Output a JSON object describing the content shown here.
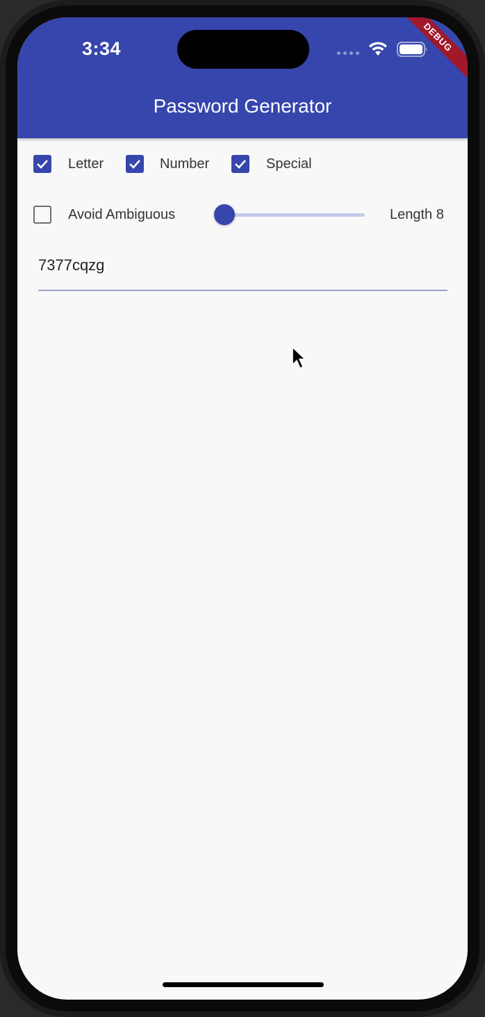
{
  "status_bar": {
    "time": "3:34"
  },
  "debug_banner": "DEBUG",
  "app_bar": {
    "title": "Password Generator"
  },
  "options": {
    "letter": {
      "label": "Letter",
      "checked": true
    },
    "number": {
      "label": "Number",
      "checked": true
    },
    "special": {
      "label": "Special",
      "checked": true
    },
    "avoid_ambiguous": {
      "label": "Avoid Ambiguous",
      "checked": false
    }
  },
  "length": {
    "label": "Length 8",
    "value": 8
  },
  "password": {
    "value": "7377cqzg"
  },
  "colors": {
    "primary": "#3646ad",
    "track": "#c5cbea",
    "background": "#f8f8f8",
    "debug": "#a0182a"
  }
}
